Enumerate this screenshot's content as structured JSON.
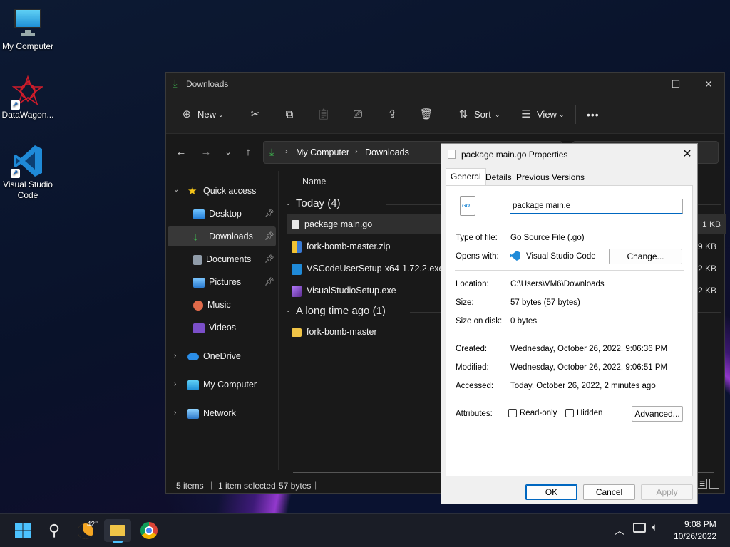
{
  "desktop": {
    "icons": [
      {
        "label": "My Computer"
      },
      {
        "label": "DataWagon..."
      },
      {
        "label": "Visual Studio Code"
      }
    ]
  },
  "explorer": {
    "title": "Downloads",
    "toolbar": {
      "new_label": "New",
      "sort_label": "Sort",
      "view_label": "View",
      "more_label": "•••"
    },
    "breadcrumb": [
      "My Computer",
      "Downloads"
    ],
    "column_name": "Name",
    "sidebar": {
      "quick_access": "Quick access",
      "items": [
        "Desktop",
        "Downloads",
        "Documents",
        "Pictures",
        "Music",
        "Videos"
      ],
      "onedrive": "OneDrive",
      "my_computer": "My Computer",
      "network": "Network"
    },
    "groups": [
      {
        "title": "Today (4)",
        "files": [
          "package main.go",
          "fork-bomb-master.zip",
          "VSCodeUserSetup-x64-1.72.2.exe",
          "VisualStudioSetup.exe"
        ]
      },
      {
        "title": "A long time ago (1)",
        "files": [
          "fork-bomb-master"
        ]
      }
    ],
    "sizes": [
      "1 KB",
      "9 KB",
      "2 KB",
      "2 KB"
    ],
    "status": {
      "items": "5 items",
      "selected": "1 item selected",
      "bytes": "57 bytes"
    }
  },
  "dialog": {
    "title": "package main.go Properties",
    "tabs": [
      "General",
      "Details",
      "Previous Versions"
    ],
    "filename_value": "package main.e",
    "labels": {
      "type": "Type of file:",
      "opens": "Opens with:",
      "location": "Location:",
      "size": "Size:",
      "size_disk": "Size on disk:",
      "created": "Created:",
      "modified": "Modified:",
      "accessed": "Accessed:",
      "attributes": "Attributes:"
    },
    "values": {
      "type": "Go Source File (.go)",
      "opens": "Visual Studio Code",
      "location": "C:\\Users\\VM6\\Downloads",
      "size": "57 bytes (57 bytes)",
      "size_disk": "0 bytes",
      "created": "Wednesday, October 26, 2022, 9:06:36 PM",
      "modified": "Wednesday, October 26, 2022, 9:06:51 PM",
      "accessed": "Today, October 26, 2022, 2 minutes ago"
    },
    "file_icon_text": "GO",
    "change_label": "Change...",
    "readonly_label": "Read-only",
    "hidden_label": "Hidden",
    "advanced_label": "Advanced...",
    "ok_label": "OK",
    "cancel_label": "Cancel",
    "apply_label": "Apply"
  },
  "taskbar": {
    "weather_temp": "42°",
    "time": "9:08 PM",
    "date": "10/26/2022"
  }
}
